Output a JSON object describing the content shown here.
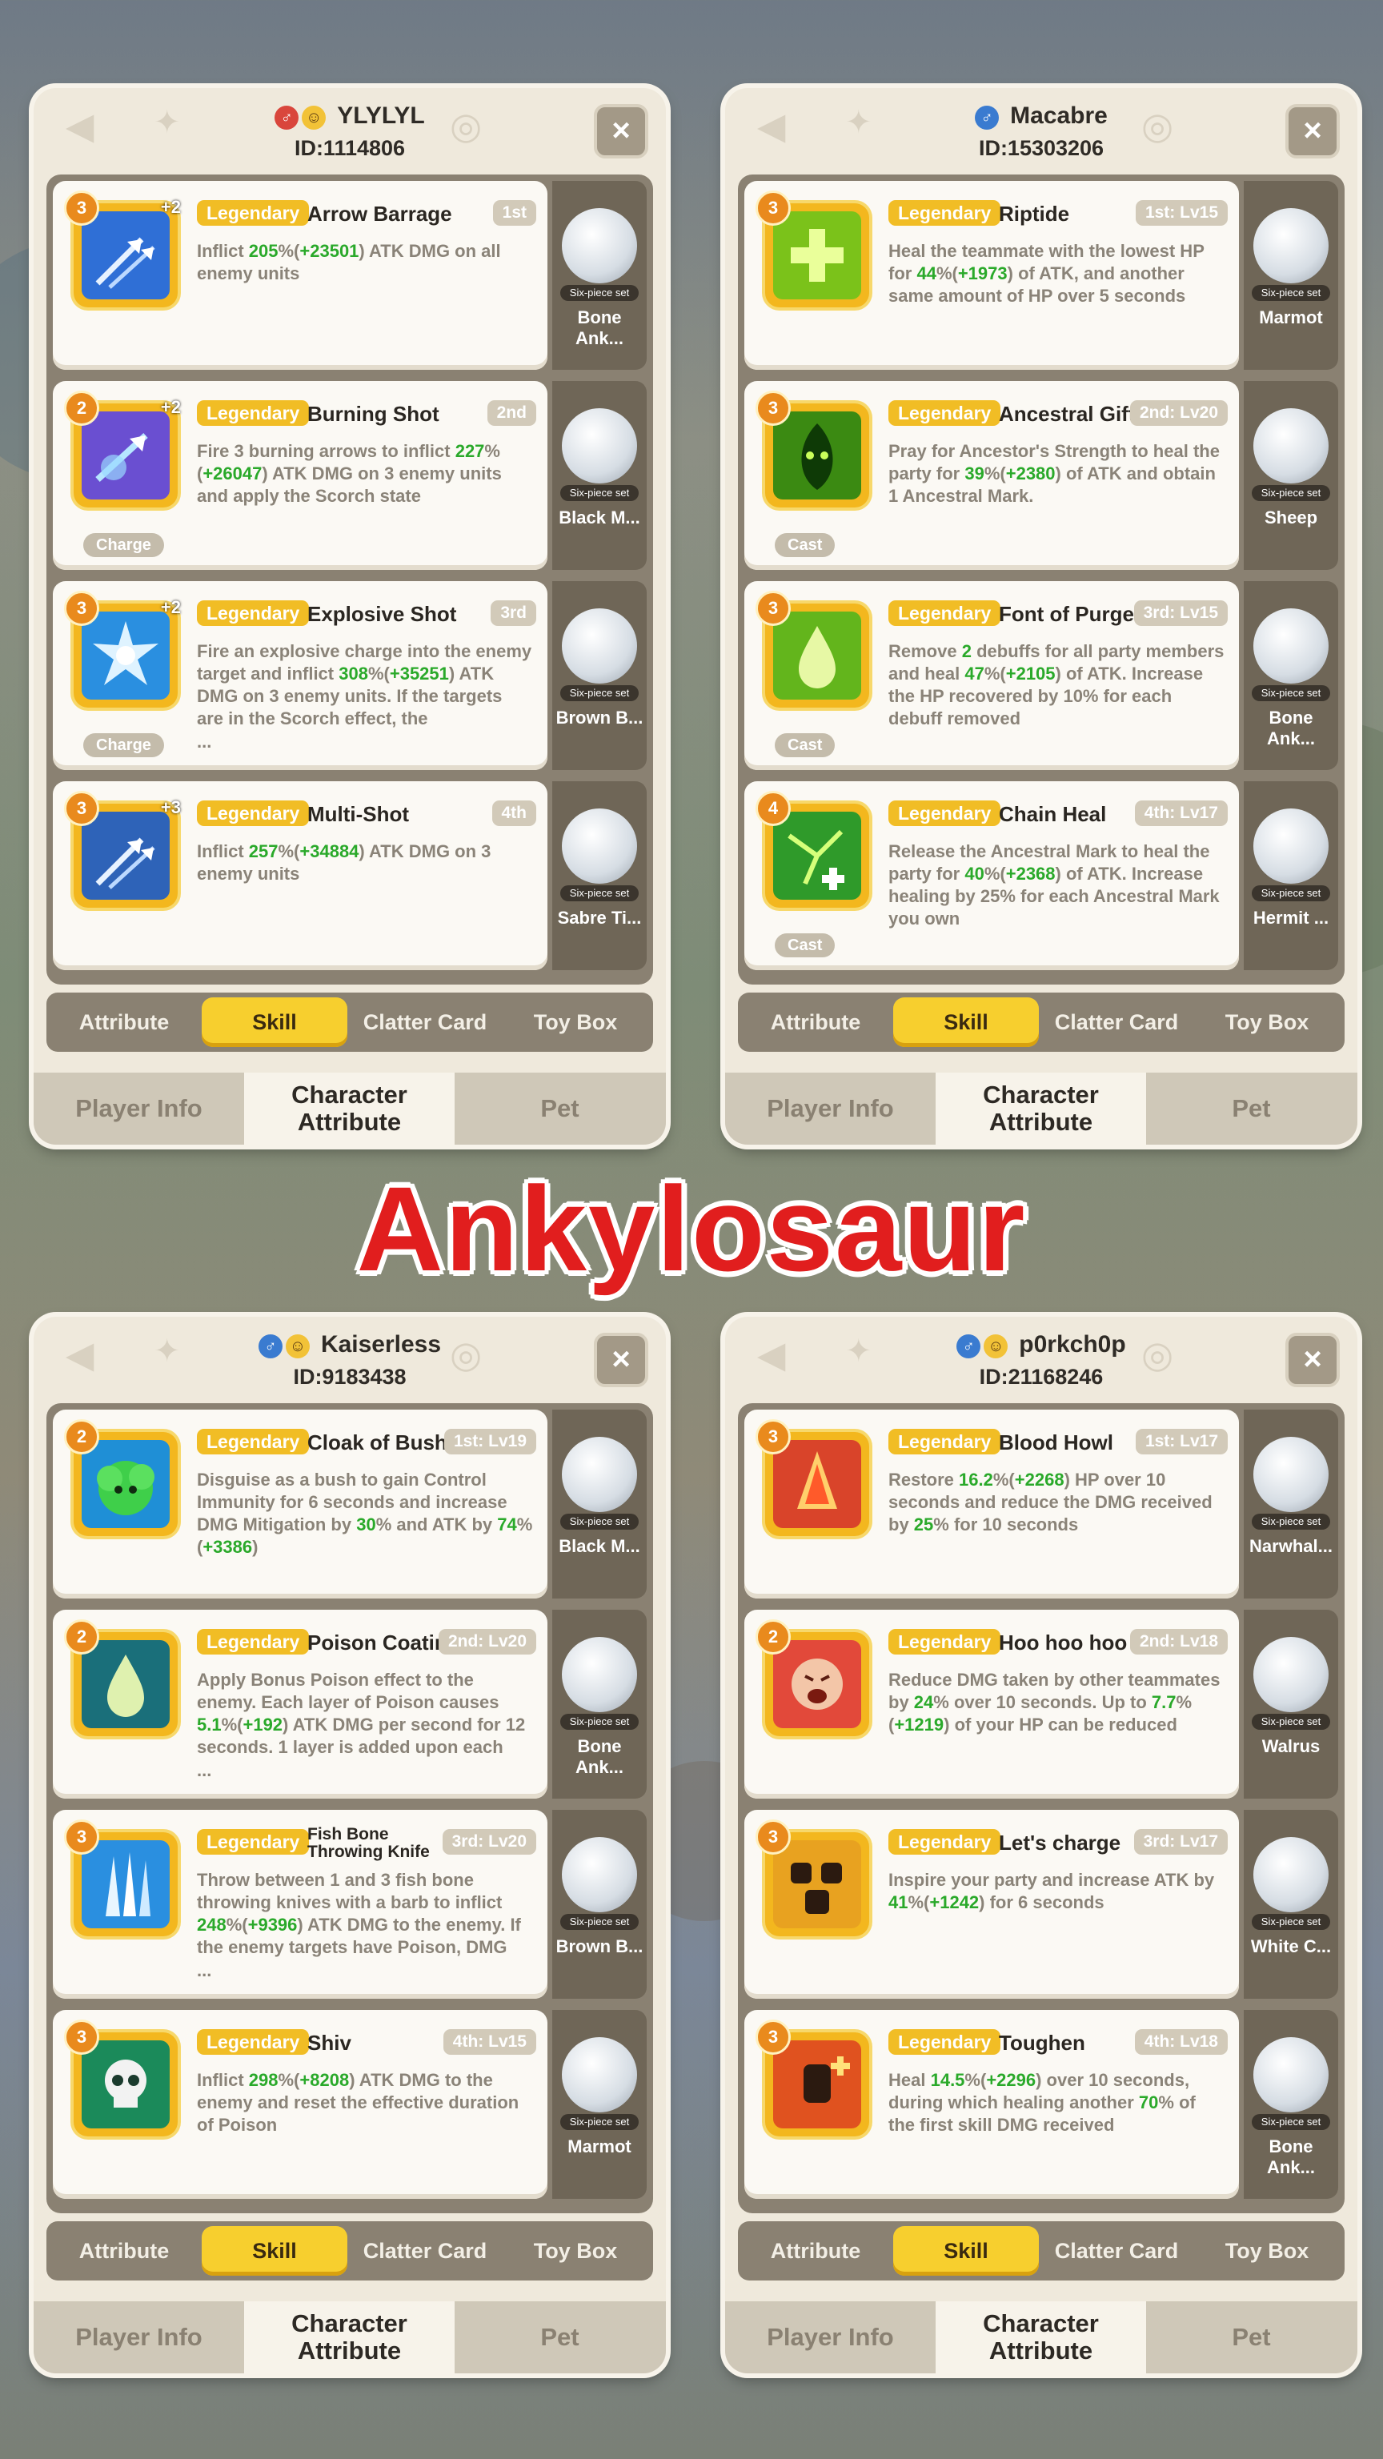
{
  "banner": "Ankylosaur",
  "common": {
    "rarity": "Legendary",
    "pet_set": "Six-piece set",
    "tabs": [
      "Attribute",
      "Skill",
      "Clatter Card",
      "Toy Box"
    ],
    "active_tab": "Skill",
    "bottom_nav": [
      "Player Info",
      "Character Attribute",
      "Pet"
    ],
    "active_bottom": "Character Attribute",
    "close_label": "×"
  },
  "panels": [
    {
      "player_name": "YLYLYL",
      "player_id": "ID:1114806",
      "badges": [
        "red",
        "smile"
      ],
      "skills": [
        {
          "level": "3",
          "plus": "+2",
          "name": "Arrow Barrage",
          "order": "1st",
          "tag": "",
          "desc": [
            [
              "Inflict ",
              ""
            ],
            [
              "205",
              "g"
            ],
            [
              "%(",
              ""
            ],
            [
              "+23501",
              "g"
            ],
            [
              ") ATK DMG on all enemy units",
              ""
            ]
          ],
          "ellipsis": "",
          "pet": "Bone Ank...",
          "icon": "arrows-icon",
          "color": "#2f6fd6"
        },
        {
          "level": "2",
          "plus": "+2",
          "name": "Burning Shot",
          "order": "2nd",
          "tag": "Charge",
          "desc": [
            [
              "Fire 3 burning arrows to inflict ",
              ""
            ],
            [
              "227",
              "g"
            ],
            [
              "%(",
              ""
            ],
            [
              "+26047",
              "g"
            ],
            [
              ") ATK DMG on 3 enemy units and apply the Scorch state",
              ""
            ]
          ],
          "ellipsis": "",
          "pet": "Black M...",
          "icon": "flame-arrows-icon",
          "color": "#6a4fd1"
        },
        {
          "level": "3",
          "plus": "+2",
          "name": "Explosive Shot",
          "order": "3rd",
          "tag": "Charge",
          "desc": [
            [
              "Fire an explosive charge into the enemy target and inflict ",
              ""
            ],
            [
              "308",
              "g"
            ],
            [
              "%(",
              ""
            ],
            [
              "+35251",
              "g"
            ],
            [
              ") ATK DMG on 3 enemy units. If the targets are in the Scorch effect, the",
              ""
            ]
          ],
          "ellipsis": "...",
          "pet": "Brown B...",
          "icon": "explosion-icon",
          "color": "#2a8fe0"
        },
        {
          "level": "3",
          "plus": "+3",
          "name": "Multi-Shot",
          "order": "4th",
          "tag": "",
          "desc": [
            [
              "Inflict ",
              ""
            ],
            [
              "257",
              "g"
            ],
            [
              "%(",
              ""
            ],
            [
              "+34884",
              "g"
            ],
            [
              ") ATK DMG on 3 enemy units",
              ""
            ]
          ],
          "ellipsis": "",
          "pet": "Sabre Ti...",
          "icon": "multi-arrow-icon",
          "color": "#2e63b8"
        }
      ]
    },
    {
      "player_name": "Macabre",
      "player_id": "ID:15303206",
      "badges": [
        "blue"
      ],
      "skills": [
        {
          "level": "3",
          "plus": "",
          "name": "Riptide",
          "order": "1st: Lv15",
          "tag": "",
          "desc": [
            [
              "Heal the teammate with the lowest HP for ",
              ""
            ],
            [
              "44",
              "g"
            ],
            [
              "%(",
              ""
            ],
            [
              "+1973",
              "g"
            ],
            [
              ") of ATK, and another same amount of HP over 5 seconds",
              ""
            ]
          ],
          "ellipsis": "",
          "pet": "Marmot",
          "icon": "heal-cross-icon",
          "color": "#7bc21a"
        },
        {
          "level": "3",
          "plus": "",
          "name": "Ancestral Gift",
          "order": "2nd: Lv20",
          "tag": "Cast",
          "desc": [
            [
              "Pray for Ancestor's Strength to heal the party for ",
              ""
            ],
            [
              "39",
              "g"
            ],
            [
              "%(",
              ""
            ],
            [
              "+2380",
              "g"
            ],
            [
              ") of ATK and obtain 1 Ancestral Mark.",
              ""
            ]
          ],
          "ellipsis": "",
          "pet": "Sheep",
          "icon": "spirit-icon",
          "color": "#3b8a12"
        },
        {
          "level": "3",
          "plus": "",
          "name": "Font of Purge",
          "order": "3rd: Lv15",
          "tag": "Cast",
          "desc": [
            [
              "Remove ",
              ""
            ],
            [
              "2",
              "g"
            ],
            [
              " debuffs for all party members and heal ",
              ""
            ],
            [
              "47",
              "g"
            ],
            [
              "%(",
              ""
            ],
            [
              "+2105",
              "g"
            ],
            [
              ") of ATK. Increase the HP recovered by 10% for each debuff removed",
              ""
            ]
          ],
          "ellipsis": "",
          "pet": "Bone Ank...",
          "icon": "droplet-icon",
          "color": "#63b51c"
        },
        {
          "level": "4",
          "plus": "",
          "name": "Chain Heal",
          "order": "4th: Lv17",
          "tag": "Cast",
          "desc": [
            [
              "Release the Ancestral Mark to heal the party for ",
              ""
            ],
            [
              "40",
              "g"
            ],
            [
              "%(",
              ""
            ],
            [
              "+2368",
              "g"
            ],
            [
              ") of ATK. Increase healing by 25% for each Ancestral Mark you own",
              ""
            ]
          ],
          "ellipsis": "",
          "pet": "Hermit ...",
          "icon": "chain-heal-icon",
          "color": "#2f9a2a"
        }
      ]
    },
    {
      "player_name": "Kaiserless",
      "player_id": "ID:9183438",
      "badges": [
        "blue",
        "smile"
      ],
      "skills": [
        {
          "level": "2",
          "plus": "",
          "name": "Cloak of Bush",
          "order": "1st: Lv19",
          "tag": "",
          "desc": [
            [
              "Disguise as a bush to gain Control Immunity for 6 seconds and increase DMG Mitigation by ",
              ""
            ],
            [
              "30",
              "g"
            ],
            [
              "% and ATK by ",
              ""
            ],
            [
              "74",
              "g"
            ],
            [
              "%(",
              ""
            ],
            [
              "+3386",
              "g"
            ],
            [
              ")",
              ""
            ]
          ],
          "ellipsis": "",
          "pet": "Black M...",
          "icon": "bush-icon",
          "color": "#1f8fd6"
        },
        {
          "level": "2",
          "plus": "",
          "name": "Poison Coating",
          "order": "2nd: Lv20",
          "tag": "",
          "desc": [
            [
              "Apply Bonus Poison effect to the enemy. Each layer of Poison causes ",
              ""
            ],
            [
              "5.1",
              "g"
            ],
            [
              "%(",
              ""
            ],
            [
              "+192",
              "g"
            ],
            [
              ") ATK DMG per second for 12 seconds. 1 layer is added upon each",
              ""
            ]
          ],
          "ellipsis": "...",
          "pet": "Bone Ank...",
          "icon": "poison-drop-icon",
          "color": "#1a6f7a"
        },
        {
          "level": "3",
          "plus": "",
          "name": "Fish Bone Throwing Knife",
          "order": "3rd: Lv20",
          "tag": "",
          "desc": [
            [
              "Throw between 1 and 3 fish bone throwing knives with a barb to inflict ",
              ""
            ],
            [
              "248",
              "g"
            ],
            [
              "%(",
              ""
            ],
            [
              "+9396",
              "g"
            ],
            [
              ") ATK DMG to the enemy. If the enemy targets have Poison, DMG",
              ""
            ]
          ],
          "ellipsis": "...",
          "pet": "Brown B...",
          "icon": "knife-icon",
          "color": "#2a8fe0"
        },
        {
          "level": "3",
          "plus": "",
          "name": "Shiv",
          "order": "4th: Lv15",
          "tag": "",
          "desc": [
            [
              "Inflict ",
              ""
            ],
            [
              "298",
              "g"
            ],
            [
              "%(",
              ""
            ],
            [
              "+8208",
              "g"
            ],
            [
              ") ATK DMG to the enemy and reset the effective duration of Poison",
              ""
            ]
          ],
          "ellipsis": "",
          "pet": "Marmot",
          "icon": "skull-icon",
          "color": "#1b8a5a"
        }
      ]
    },
    {
      "player_name": "p0rkch0p",
      "player_id": "ID:21168246",
      "badges": [
        "blue",
        "smile"
      ],
      "skills": [
        {
          "level": "3",
          "plus": "",
          "name": "Blood Howl",
          "order": "1st: Lv17",
          "tag": "",
          "desc": [
            [
              "Restore ",
              ""
            ],
            [
              "16.2",
              "g"
            ],
            [
              "%(",
              ""
            ],
            [
              "+2268",
              "g"
            ],
            [
              ") HP over 10 seconds and reduce the DMG received by ",
              ""
            ],
            [
              "25",
              "g"
            ],
            [
              "% for 10 seconds",
              ""
            ]
          ],
          "ellipsis": "",
          "pet": "Narwhal...",
          "icon": "blood-icon",
          "color": "#d9442a"
        },
        {
          "level": "2",
          "plus": "",
          "name": "Hoo hoo hoo",
          "order": "2nd: Lv18",
          "tag": "",
          "desc": [
            [
              "Reduce DMG taken by other teammates by ",
              ""
            ],
            [
              "24",
              "g"
            ],
            [
              "% over 10 seconds. Up to ",
              ""
            ],
            [
              "7.7",
              "g"
            ],
            [
              "%(",
              ""
            ],
            [
              "+1219",
              "g"
            ],
            [
              ") of your HP can be reduced",
              ""
            ]
          ],
          "ellipsis": "",
          "pet": "Walrus",
          "icon": "shout-icon",
          "color": "#e2493a"
        },
        {
          "level": "3",
          "plus": "",
          "name": "Let's charge",
          "order": "3rd: Lv17",
          "tag": "",
          "desc": [
            [
              "Inspire your party and increase ATK by ",
              ""
            ],
            [
              "41",
              "g"
            ],
            [
              "%(",
              ""
            ],
            [
              "+1242",
              "g"
            ],
            [
              ") for 6 seconds",
              ""
            ]
          ],
          "ellipsis": "",
          "pet": "White C...",
          "icon": "rally-icon",
          "color": "#e8a220"
        },
        {
          "level": "3",
          "plus": "",
          "name": "Toughen",
          "order": "4th: Lv18",
          "tag": "",
          "desc": [
            [
              "Heal ",
              ""
            ],
            [
              "14.5",
              "g"
            ],
            [
              "%(",
              ""
            ],
            [
              "+2296",
              "g"
            ],
            [
              ") over 10 seconds, during which healing another ",
              ""
            ],
            [
              "70",
              "g"
            ],
            [
              "% of the first skill DMG received",
              ""
            ]
          ],
          "ellipsis": "",
          "pet": "Bone Ank...",
          "icon": "toughen-icon",
          "color": "#e0521f"
        }
      ]
    }
  ]
}
